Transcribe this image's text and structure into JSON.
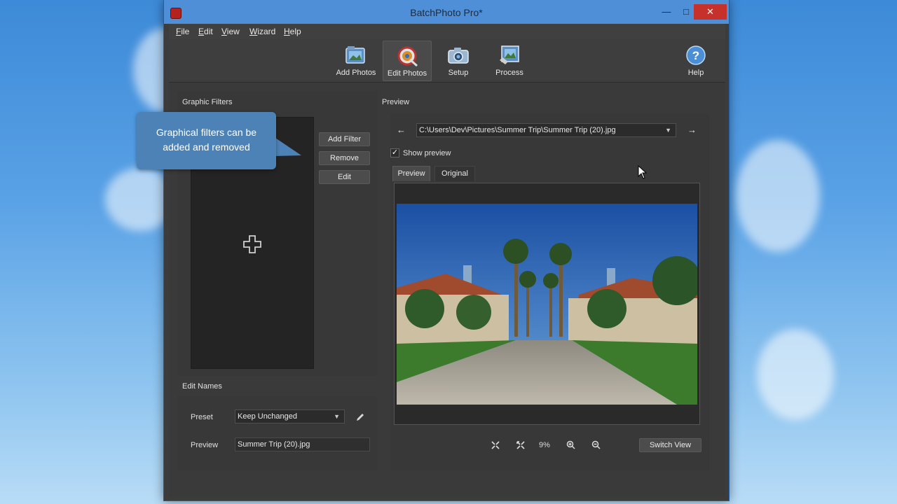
{
  "window": {
    "title": "BatchPhoto Pro*"
  },
  "menu": [
    "File",
    "Edit",
    "View",
    "Wizard",
    "Help"
  ],
  "toolbar": {
    "add_photos": "Add Photos",
    "edit_photos": "Edit Photos",
    "setup": "Setup",
    "process": "Process",
    "help": "Help"
  },
  "graphic_filters": {
    "label": "Graphic Filters",
    "add_filter": "Add Filter",
    "remove": "Remove",
    "edit": "Edit"
  },
  "tooltip": {
    "text_line1": "Graphical filters can be",
    "text_line2": "added and removed"
  },
  "edit_names": {
    "label": "Edit Names",
    "preset_label": "Preset",
    "preset_value": "Keep Unchanged",
    "preview_label": "Preview",
    "preview_value": "Summer Trip (20).jpg"
  },
  "preview": {
    "label": "Preview",
    "file_path": "C:\\Users\\Dev\\Pictures\\Summer Trip\\Summer Trip (20).jpg",
    "show_preview_label": "Show preview",
    "show_preview_checked": true,
    "tabs": [
      "Preview",
      "Original"
    ],
    "zoom_level": "9%",
    "switch_view": "Switch View"
  },
  "colors": {
    "accent_titlebar": "#4f8fd8",
    "tooltip_bg": "#4d82b7",
    "close_btn": "#c7312b"
  }
}
